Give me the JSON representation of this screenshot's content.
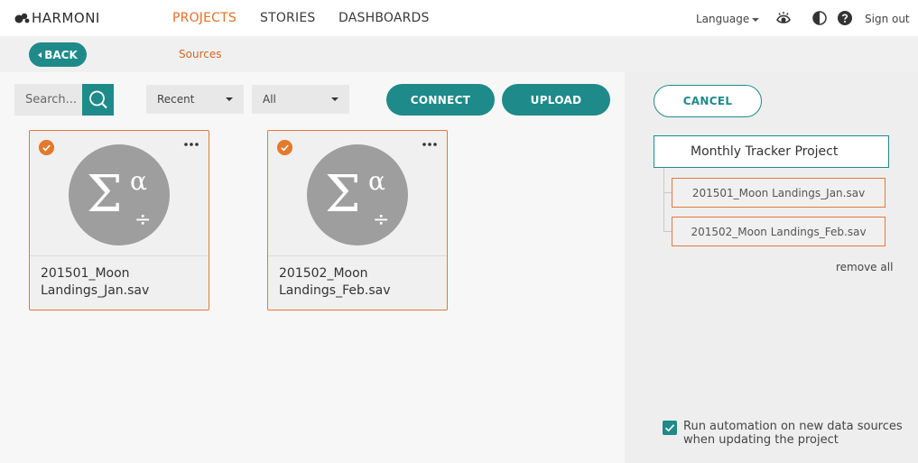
{
  "brand": {
    "name": "HARMONI"
  },
  "nav": {
    "tabs": [
      {
        "label": "PROJECTS",
        "active": true
      },
      {
        "label": "STORIES",
        "active": false
      },
      {
        "label": "DASHBOARDS",
        "active": false
      }
    ],
    "language_label": "Language",
    "sign_out_label": "Sign out"
  },
  "subbar": {
    "back_label": "BACK",
    "breadcrumb": "Sources"
  },
  "toolbar": {
    "search_placeholder": "Search...",
    "sort_value": "Recent",
    "filter_value": "All",
    "connect_label": "CONNECT",
    "upload_label": "UPLOAD"
  },
  "cards": [
    {
      "title_line1": "201501_Moon",
      "title_line2": "Landings_Jan.sav",
      "selected": true
    },
    {
      "title_line1": "201502_Moon",
      "title_line2": "Landings_Feb.sav",
      "selected": true
    }
  ],
  "panel": {
    "cancel_label": "CANCEL",
    "project_name": "Monthly Tracker Project",
    "sources": [
      "201501_Moon Landings_Jan.sav",
      "201502_Moon Landings_Feb.sav"
    ],
    "remove_all_label": "remove all",
    "automation_checked": true,
    "automation_label": "Run automation on new data sources when updating the project"
  },
  "colors": {
    "accent_teal": "#1f8a8a",
    "accent_orange": "#e56f26",
    "card_border": "#e07a3a"
  },
  "icons": {
    "eye": "eye-icon",
    "contrast": "contrast-icon",
    "help": "help-icon",
    "search": "search-icon",
    "check": "check-icon",
    "more": "more-icon",
    "formula": "formula-icon"
  }
}
